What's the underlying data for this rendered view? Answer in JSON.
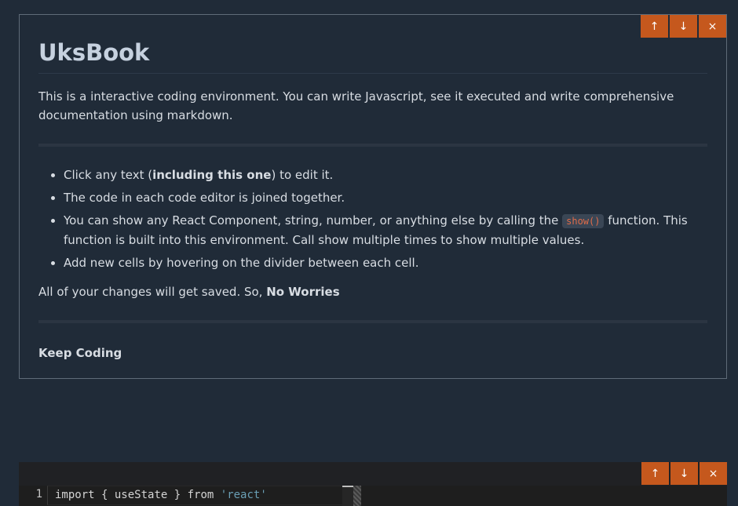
{
  "markdown_cell": {
    "actions": {
      "up_icon": "↑",
      "down_icon": "↓",
      "close_icon": "×"
    },
    "title": "UksBook",
    "intro": "This is a interactive coding environment. You can write Javascript, see it executed and write comprehensive documentation using markdown.",
    "bullets": [
      {
        "pre": "Click any text (",
        "bold": "including this one",
        "post": ") to edit it."
      },
      {
        "text": "The code in each code editor is joined together."
      },
      {
        "pre": "You can show any React Component, string, number, or anything else by calling the ",
        "code": "show()",
        "post": " function. This function is built into this environment. Call show multiple times to show multiple values."
      },
      {
        "text": "Add new cells by hovering on the divider between each cell."
      }
    ],
    "outro_pre": "All of your changes will get saved. So, ",
    "outro_bold": "No Worries",
    "footer": "Keep Coding"
  },
  "code_cell": {
    "actions": {
      "up_icon": "↑",
      "down_icon": "↓",
      "close_icon": "×"
    },
    "line_number": "1",
    "tokens": {
      "import": "import",
      "brace_open": " { ",
      "ident": "useState",
      "brace_close": " } ",
      "from": "from",
      "space": " ",
      "string": "'react'"
    }
  },
  "colors": {
    "background": "#202b38",
    "accent": "#c5581d",
    "border": "#5f6b78",
    "code_string": "#6a9fb5",
    "inline_code": "#e06c4a"
  }
}
